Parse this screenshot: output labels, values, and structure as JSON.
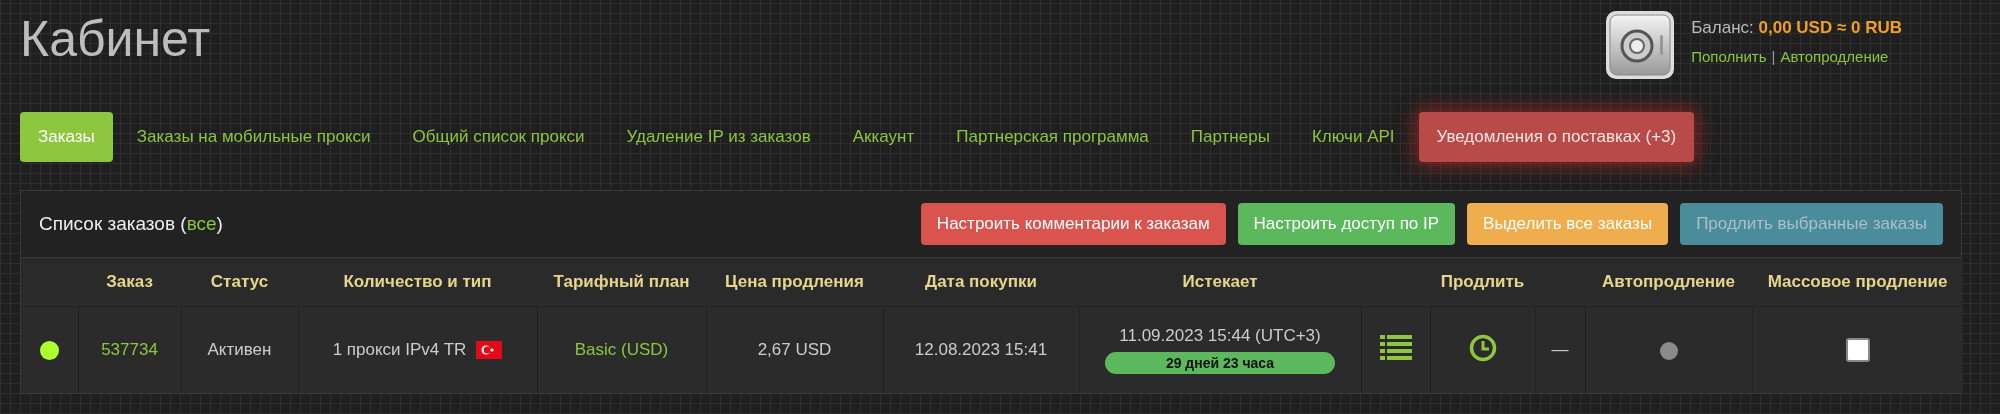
{
  "page_title": "Кабинет",
  "balance": {
    "label": "Баланс:",
    "amount": "0,00 USD ≈ 0 RUB",
    "links": [
      "Пополнить",
      "Автопродление"
    ],
    "separator": "|"
  },
  "tabs": [
    {
      "label": "Заказы",
      "selected": true,
      "kind": "normal"
    },
    {
      "label": "Заказы на мобильные прокси",
      "selected": false,
      "kind": "normal"
    },
    {
      "label": "Общий список прокси",
      "selected": false,
      "kind": "normal"
    },
    {
      "label": "Удаление IP из заказов",
      "selected": false,
      "kind": "normal"
    },
    {
      "label": "Аккаунт",
      "selected": false,
      "kind": "normal"
    },
    {
      "label": "Партнерская программа",
      "selected": false,
      "kind": "normal"
    },
    {
      "label": "Партнеры",
      "selected": false,
      "kind": "normal"
    },
    {
      "label": "Ключи API",
      "selected": false,
      "kind": "normal"
    },
    {
      "label": "Уведомления о поставках (+3)",
      "selected": false,
      "kind": "alert"
    }
  ],
  "panel": {
    "title_start": "Список заказов (",
    "filter_link": "все",
    "title_end": ")",
    "buttons": [
      {
        "label": "Настроить комментарии к заказам",
        "kind": "danger",
        "disabled": false
      },
      {
        "label": "Настроить доступ по IP",
        "kind": "success",
        "disabled": false
      },
      {
        "label": "Выделить все заказы",
        "kind": "warning",
        "disabled": false
      },
      {
        "label": "Продлить выбранные заказы",
        "kind": "info",
        "disabled": true
      }
    ]
  },
  "table": {
    "columns": [
      "",
      "Заказ",
      "Статус",
      "Количество и тип",
      "Тарифный план",
      "Цена продления",
      "Дата покупки",
      "Истекает",
      "",
      "Продлить",
      "",
      "Автопродление",
      "Массовое продление"
    ],
    "rows": [
      {
        "color": "#adff2f",
        "order": "537734",
        "status": "Активен",
        "quantity": "1 прокси IPv4 TR",
        "plan": "Basic (USD)",
        "price": "2,67 USD",
        "purchase_date": "12.08.2023 15:41",
        "expires": "11.09.2023 15:44 (UTC+3)",
        "remaining": "29 дней 23 часа",
        "renew_note": "—",
        "autorenew": false,
        "checked": false
      }
    ]
  }
}
